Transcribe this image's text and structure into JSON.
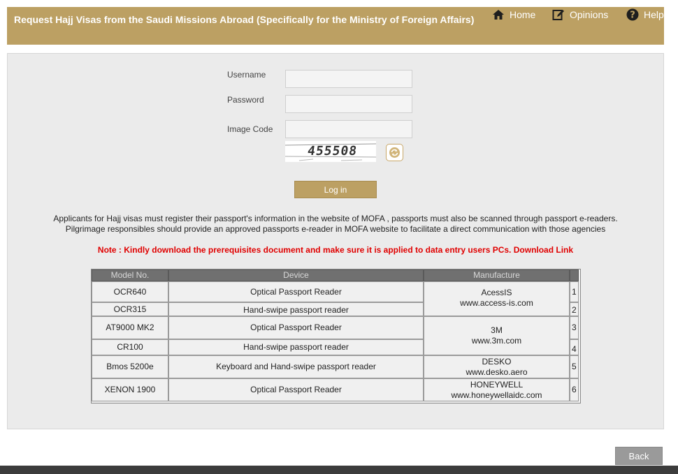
{
  "header": {
    "title": "Request Hajj Visas from the Saudi Missions Abroad (Specifically for the Ministry of Foreign Affairs)",
    "nav": {
      "home": "Home",
      "opinions": "Opinions",
      "help": "Help"
    }
  },
  "form": {
    "username_label": "Username",
    "password_label": "Password",
    "image_code_label": "Image Code",
    "username_value": "",
    "password_value": "",
    "image_code_value": "",
    "captcha_text": "455508",
    "login_label": "Log in"
  },
  "info": {
    "line1": "Applicants for Hajj visas must register their passport's information in the website of MOFA , passports must also be scanned through passport e-readers.",
    "line2": "Pilgrimage responsibles should provide an approved passports e-reader in MOFA website to facilitate a direct communication with those agencies"
  },
  "note": {
    "text": "Note : Kindly download the prerequisites document and make sure it is applied to data entry users PCs.",
    "link": "Download Link"
  },
  "table": {
    "headers": {
      "model": "Model No.",
      "device": "Device",
      "manufacture": "Manufacture"
    },
    "rows": [
      {
        "model": "OCR640",
        "device": "Optical Passport Reader",
        "num": "1"
      },
      {
        "model": "OCR315",
        "device": "Hand-swipe passport reader",
        "num": "2"
      },
      {
        "model": "AT9000 MK2",
        "device": "Optical Passport Reader",
        "num": "3"
      },
      {
        "model": "CR100",
        "device": "Hand-swipe passport reader",
        "num": "4"
      },
      {
        "model": "Bmos 5200e",
        "device": "Keyboard and Hand-swipe passport reader",
        "num": "5"
      },
      {
        "model": "XENON 1900",
        "device": "Optical Passport Reader",
        "num": "6"
      }
    ],
    "manufacturers": [
      {
        "name": "AcessIS",
        "site": "www.access-is.com"
      },
      {
        "name": "3M",
        "site": "www.3m.com"
      },
      {
        "name": "DESKO",
        "site": "www.desko.aero"
      },
      {
        "name": "HONEYWELL",
        "site": "www.honeywellaidc.com"
      }
    ]
  },
  "footer": {
    "back_label": "Back"
  },
  "colors": {
    "brand_gold": "#bca063",
    "note_red": "#e00000",
    "panel_gray": "#ebebeb"
  }
}
